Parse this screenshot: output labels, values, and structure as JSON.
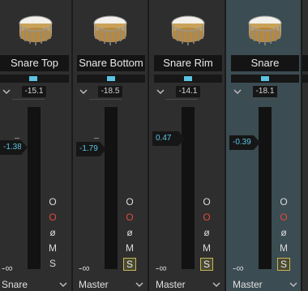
{
  "strips": [
    {
      "name": "Snare Top",
      "gain": "-15.1",
      "fader_value": "-1.38",
      "output": "Snare"
    },
    {
      "name": "Snare Bottom",
      "gain": "-18.5",
      "fader_value": "-1.79",
      "output": "Master"
    },
    {
      "name": "Snare Rim",
      "gain": "-14.1",
      "fader_value": "0.47",
      "output": "Master"
    },
    {
      "name": "Snare",
      "gain": "-18.1",
      "fader_value": "-0.39",
      "output": "Master"
    }
  ],
  "buttons": {
    "circle": "O",
    "record": "O",
    "phase": "ø",
    "mute": "M",
    "solo": "S"
  },
  "neg_infinity": "-∞",
  "colors": {
    "accent": "#5cc3e3",
    "record": "#e14a3c",
    "solo_border": "#c8b454",
    "selected_strip": "#3b4c52"
  },
  "icons": [
    "snare-drum-icon",
    "chevron-down-icon"
  ]
}
